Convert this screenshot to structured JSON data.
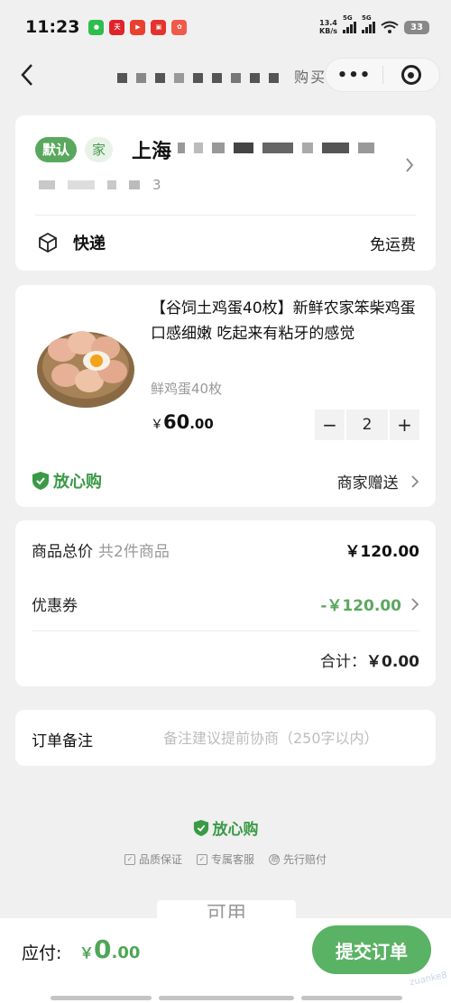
{
  "status_bar": {
    "time": "11:23",
    "app_icons": [
      "wechat",
      "tmall",
      "app-red",
      "app-shop",
      "app-game"
    ],
    "net_speed": "13.4",
    "net_speed_unit": "KB/s",
    "signal_label_1": "5G",
    "signal_label_2": "5G",
    "battery": "33"
  },
  "nav": {
    "back_icon": "chevron-left-icon",
    "title_visible": "购买",
    "more_icon": "more-dots-icon",
    "close_icon": "target-icon"
  },
  "address": {
    "tag_default": "默认",
    "tag_home": "家",
    "city": "上海",
    "detail_suffix": "3",
    "shipping_label": "快递",
    "shipping_fee": "免运费"
  },
  "item": {
    "title": "【谷饲土鸡蛋40枚】新鲜农家笨柴鸡蛋 口感细嫩 吃起来有粘牙的感觉",
    "spec": "鲜鸡蛋40枚",
    "price_currency": "￥",
    "price_int": "60",
    "price_dec": ".00",
    "quantity": "2",
    "minus": "−",
    "plus": "+",
    "assure_label": "放心购",
    "gift_label": "商家赠送"
  },
  "pricing": {
    "total_label": "商品总价",
    "total_count": "共2件商品",
    "total_value": "￥120.00",
    "coupon_label": "优惠券",
    "coupon_value": "-￥120.00",
    "sum_label": "合计：",
    "sum_value": "￥0.00"
  },
  "remark": {
    "label": "订单备注",
    "placeholder": "备注建议提前协商（250字以内）"
  },
  "footer": {
    "assure_label": "放心购",
    "guarantees": [
      "品质保证",
      "专属客服",
      "先行赔付"
    ],
    "peek_tab": "可用"
  },
  "bottom_bar": {
    "pay_label": "应付:",
    "pay_currency": "￥",
    "pay_int": "0",
    "pay_dec": ".00",
    "submit_label": "提交订单",
    "watermark": "zuanke8"
  },
  "colors": {
    "accent_green": "#59a85d",
    "price_green": "#4fa656",
    "background": "#f0f0f0"
  }
}
